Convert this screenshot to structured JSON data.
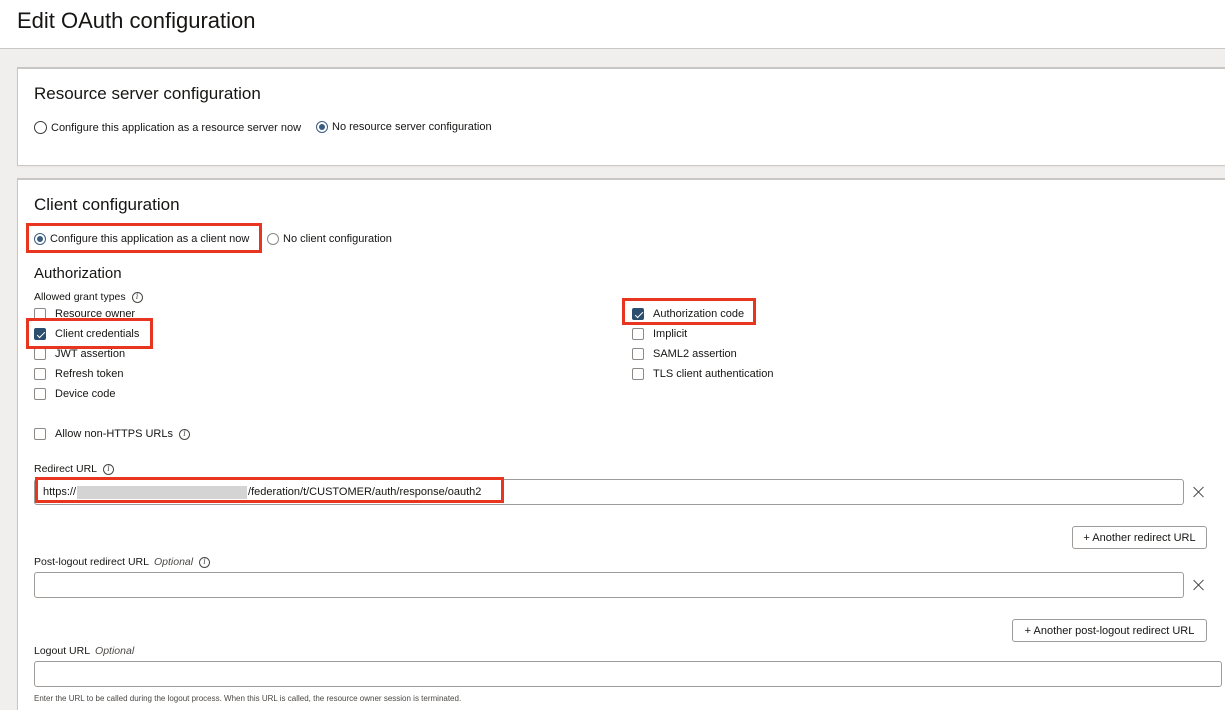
{
  "page": {
    "title": "Edit OAuth configuration"
  },
  "resource_server": {
    "title": "Resource server configuration",
    "option_configure": "Configure this application as a resource server now",
    "option_none": "No resource server configuration",
    "selected": "none"
  },
  "client": {
    "title": "Client configuration",
    "option_configure": "Configure this application as a client now",
    "option_none": "No client configuration",
    "selected": "configure",
    "authorization": {
      "title": "Authorization",
      "grant_types_label": "Allowed grant types",
      "left_grants": [
        {
          "label": "Resource owner",
          "checked": false
        },
        {
          "label": "Client credentials",
          "checked": true
        },
        {
          "label": "JWT assertion",
          "checked": false
        },
        {
          "label": "Refresh token",
          "checked": false
        },
        {
          "label": "Device code",
          "checked": false
        }
      ],
      "right_grants": [
        {
          "label": "Authorization code",
          "checked": true
        },
        {
          "label": "Implicit",
          "checked": false
        },
        {
          "label": "SAML2 assertion",
          "checked": false
        },
        {
          "label": "TLS client authentication",
          "checked": false
        }
      ],
      "allow_non_https": {
        "label": "Allow non-HTTPS URLs",
        "checked": false
      }
    },
    "redirect_url": {
      "label": "Redirect URL",
      "value_prefix": "https://",
      "value_suffix": "/federation/t/CUSTOMER/auth/response/oauth2",
      "add_button": "+ Another redirect URL"
    },
    "post_logout": {
      "label": "Post-logout redirect URL",
      "optional": "Optional",
      "value": "",
      "add_button": "+ Another post-logout redirect URL"
    },
    "logout": {
      "label": "Logout URL",
      "optional": "Optional",
      "value": "",
      "help": "Enter the URL to be called during the logout process. When this URL is called, the resource owner session is terminated."
    }
  },
  "icons": {
    "info": "info-icon",
    "close": "close-icon"
  },
  "colors": {
    "highlight": "#e8351f",
    "accent": "#2b4d6e"
  }
}
